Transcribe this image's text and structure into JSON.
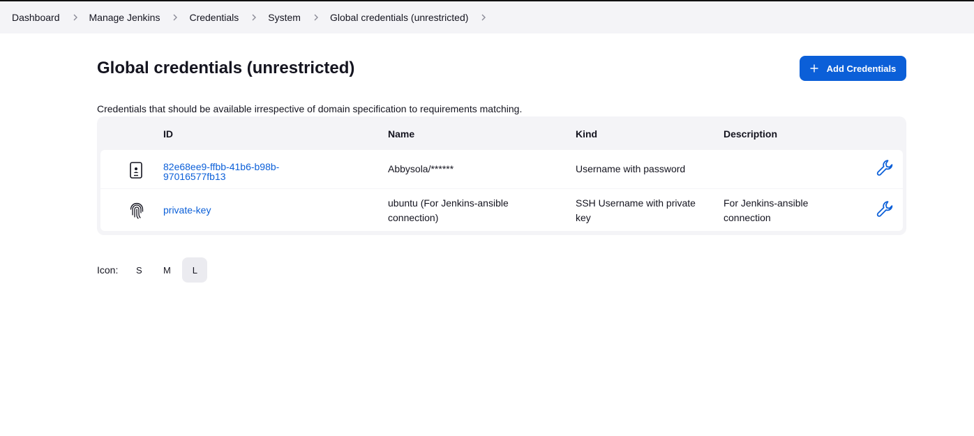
{
  "breadcrumb": [
    "Dashboard",
    "Manage Jenkins",
    "Credentials",
    "System",
    "Global credentials (unrestricted)"
  ],
  "page": {
    "title": "Global credentials (unrestricted)",
    "add_button": "Add Credentials",
    "description": "Credentials that should be available irrespective of domain specification to requirements matching."
  },
  "table": {
    "headers": {
      "id": "ID",
      "name": "Name",
      "kind": "Kind",
      "description": "Description"
    },
    "rows": [
      {
        "icon": "mobile-credential-icon",
        "id_line1": "82e68ee9-ffbb-41b6-b98b-",
        "id_line2": "97016577fb13",
        "name": "Abbysola/******",
        "kind": "Username with password",
        "description": ""
      },
      {
        "icon": "fingerprint-icon",
        "id": "private-key",
        "name_line1": "ubuntu (For Jenkins-ansible",
        "name_line2": "connection)",
        "kind_line1": "SSH Username with private",
        "kind_line2": "key",
        "description_line1": "For Jenkins-ansible",
        "description_line2": "connection"
      }
    ]
  },
  "icon_size": {
    "label": "Icon:",
    "options": [
      "S",
      "M",
      "L"
    ],
    "selected": "L"
  },
  "colors": {
    "accent": "#0b5fd8",
    "background": "#f4f4f7"
  }
}
